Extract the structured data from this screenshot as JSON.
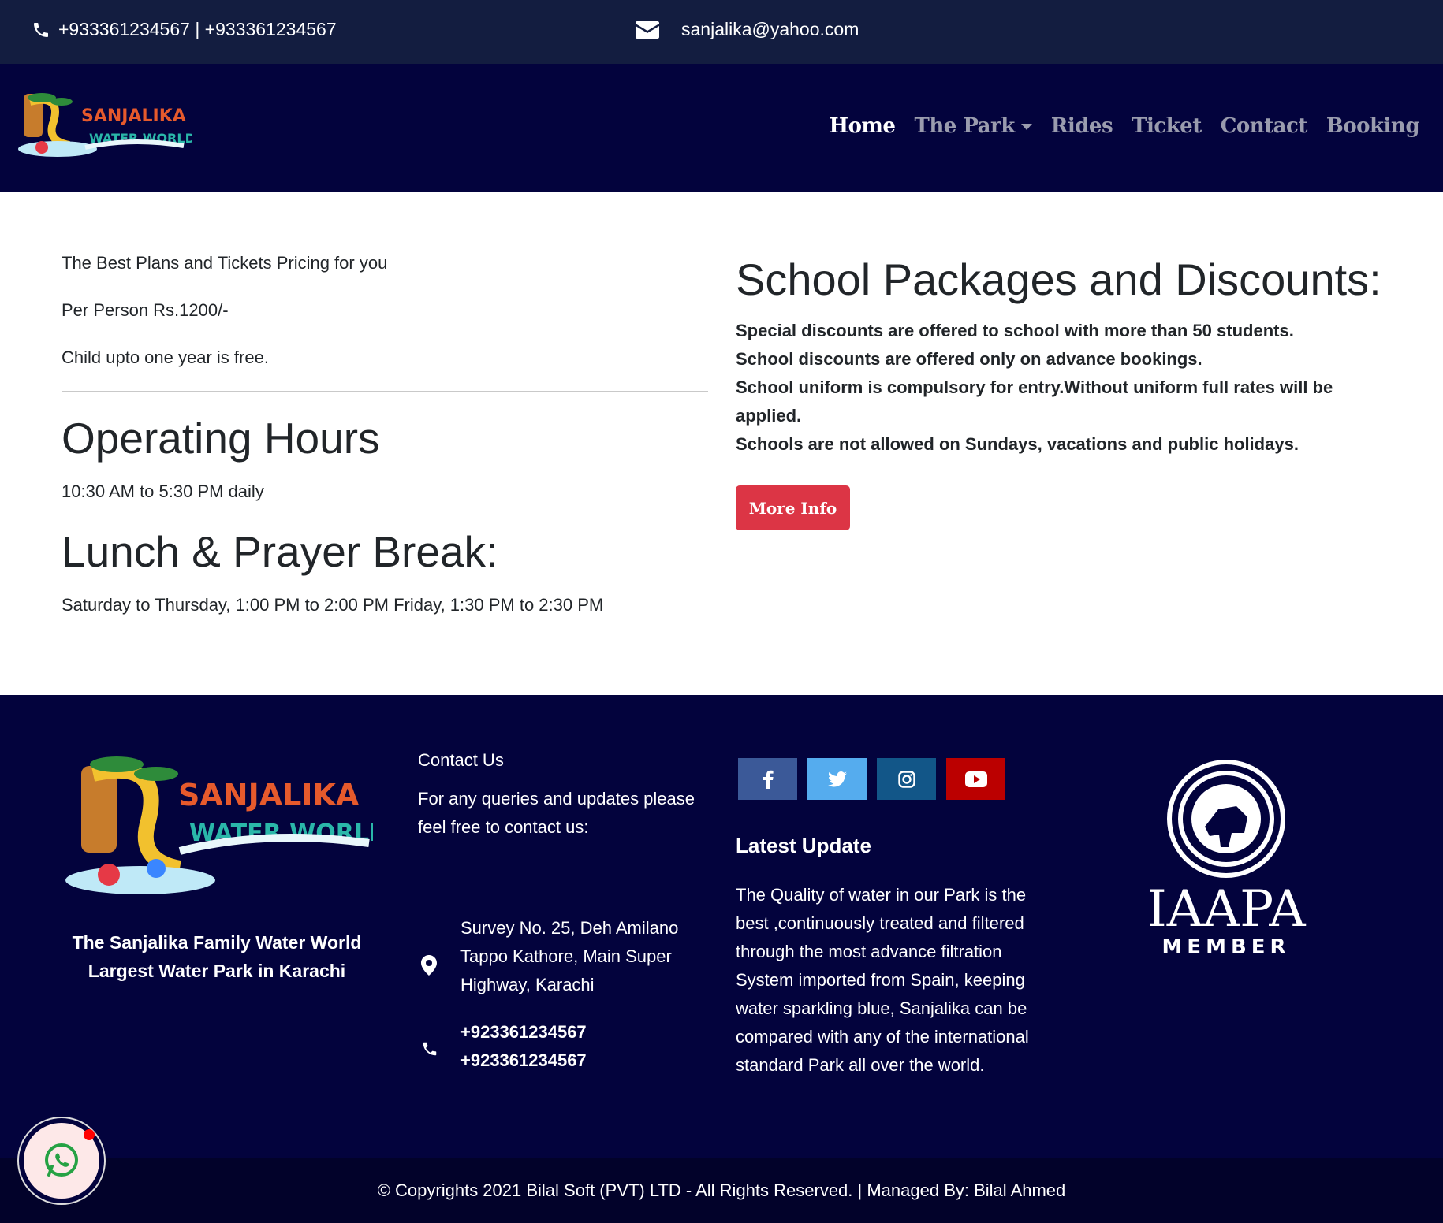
{
  "topbar": {
    "phone": "+933361234567 | +933361234567",
    "email": "sanjalika@yahoo.com"
  },
  "logo_text": {
    "line1": "SANJALIKA",
    "line2": "WATER WORLD"
  },
  "nav": {
    "items": [
      {
        "label": "Home",
        "active": true
      },
      {
        "label": "The Park",
        "dropdown": true
      },
      {
        "label": "Rides"
      },
      {
        "label": "Ticket"
      },
      {
        "label": "Contact"
      },
      {
        "label": "Booking"
      }
    ]
  },
  "pricing": {
    "intro": "The Best Plans and Tickets Pricing for you",
    "per_person": "Per Person Rs.1200/-",
    "child": "Child upto one year is free."
  },
  "hours": {
    "title": "Operating Hours",
    "text": "10:30 AM to 5:30 PM daily"
  },
  "lunch": {
    "title": "Lunch & Prayer Break:",
    "text": "Saturday to Thursday, 1:00 PM to 2:00 PM Friday, 1:30 PM to 2:30 PM"
  },
  "school": {
    "title": "School Packages and Discounts:",
    "lines": [
      "Special discounts are offered to school with more than 50 students.",
      "School discounts are offered only on advance bookings.",
      "School uniform is compulsory for entry.Without uniform full rates will be applied.",
      "Schools are not allowed on Sundays, vacations and public holidays."
    ],
    "button": "More Info"
  },
  "footer": {
    "tagline_1": "The Sanjalika Family Water World",
    "tagline_2": "Largest Water Park in Karachi",
    "contact_title": "Contact Us",
    "contact_desc": "For any queries and updates please feel free to contact us:",
    "address": "Survey No. 25, Deh Amilano Tappo Kathore, Main Super Highway, Karachi",
    "phone_1": "+923361234567",
    "phone_2": "+923361234567",
    "latest_title": "Latest Update",
    "latest_text": "The Quality of water in our Park is the best ,continuously treated and filtered through the most advance filtration System imported from Spain, keeping water sparkling blue, Sanjalika can be compared with any of the international standard Park all over the world.",
    "socials": [
      {
        "icon": "facebook-icon",
        "color": "#3b5998"
      },
      {
        "icon": "twitter-icon",
        "color": "#55acee"
      },
      {
        "icon": "instagram-icon",
        "color": "#125688"
      },
      {
        "icon": "youtube-icon",
        "color": "#bb0000"
      }
    ],
    "iaapa_1": "IAAPA",
    "iaapa_2": "MEMBER"
  },
  "copyright": "© Copyrights 2021 Bilal Soft (PVT) LTD - All Rights Reserved. | Managed By: Bilal Ahmed"
}
